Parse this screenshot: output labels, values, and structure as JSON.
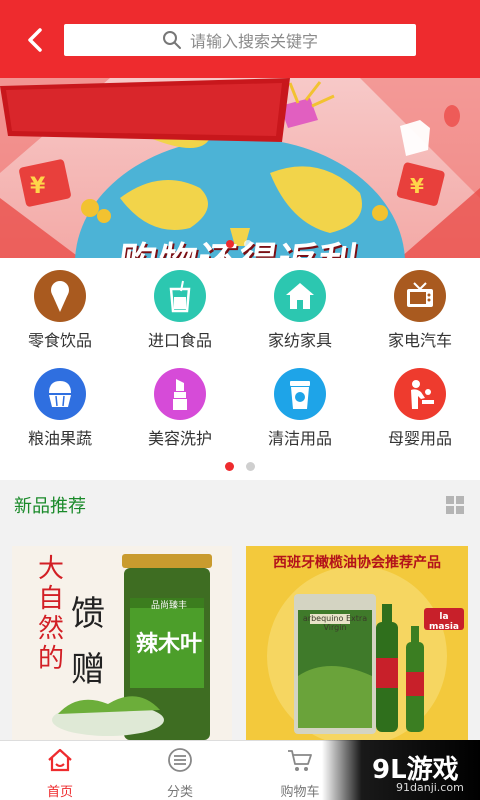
{
  "header": {
    "search_placeholder": "请输入搜索关键字",
    "accent_color": "#ee2b2e"
  },
  "banner": {
    "title": "购物还得返利",
    "slide_count": 2,
    "active_slide": 1
  },
  "categories": [
    {
      "label": "零食饮品",
      "icon": "ice-cream-icon",
      "color": "#a95a1f"
    },
    {
      "label": "进口食品",
      "icon": "drink-cup-icon",
      "color": "#2cc7b0"
    },
    {
      "label": "家纺家具",
      "icon": "house-icon",
      "color": "#2cc7b0"
    },
    {
      "label": "家电汽车",
      "icon": "television-icon",
      "color": "#a95a1f"
    },
    {
      "label": "粮油果蔬",
      "icon": "muffin-icon",
      "color": "#2f6fe0"
    },
    {
      "label": "美容洗护",
      "icon": "lipstick-icon",
      "color": "#d64bd8"
    },
    {
      "label": "清洁用品",
      "icon": "cleaning-cup-icon",
      "color": "#1ea4e8"
    },
    {
      "label": "母婴用品",
      "icon": "mother-baby-icon",
      "color": "#ee3b2e"
    }
  ],
  "category_pager": {
    "pages": 2,
    "active": 1
  },
  "new_products": {
    "title": "新品推荐",
    "items": [
      {
        "name": "辣木叶",
        "brand_text": "品尚臻丰",
        "tagline": [
          "大",
          "自",
          "然",
          "的"
        ],
        "gift": [
          "馈",
          "赠"
        ]
      },
      {
        "name": "arbequino Extra Virgin",
        "banner_text": "西班牙橄榄油协会推荐产品",
        "brand": "la masia"
      }
    ]
  },
  "tabbar": {
    "tabs": [
      {
        "label": "首页",
        "icon": "home-icon",
        "active": true
      },
      {
        "label": "分类",
        "icon": "category-icon",
        "active": false
      },
      {
        "label": "购物车",
        "icon": "cart-icon",
        "active": false
      }
    ]
  },
  "watermark": {
    "logo": "9L游戏",
    "url": "91danji.com"
  }
}
